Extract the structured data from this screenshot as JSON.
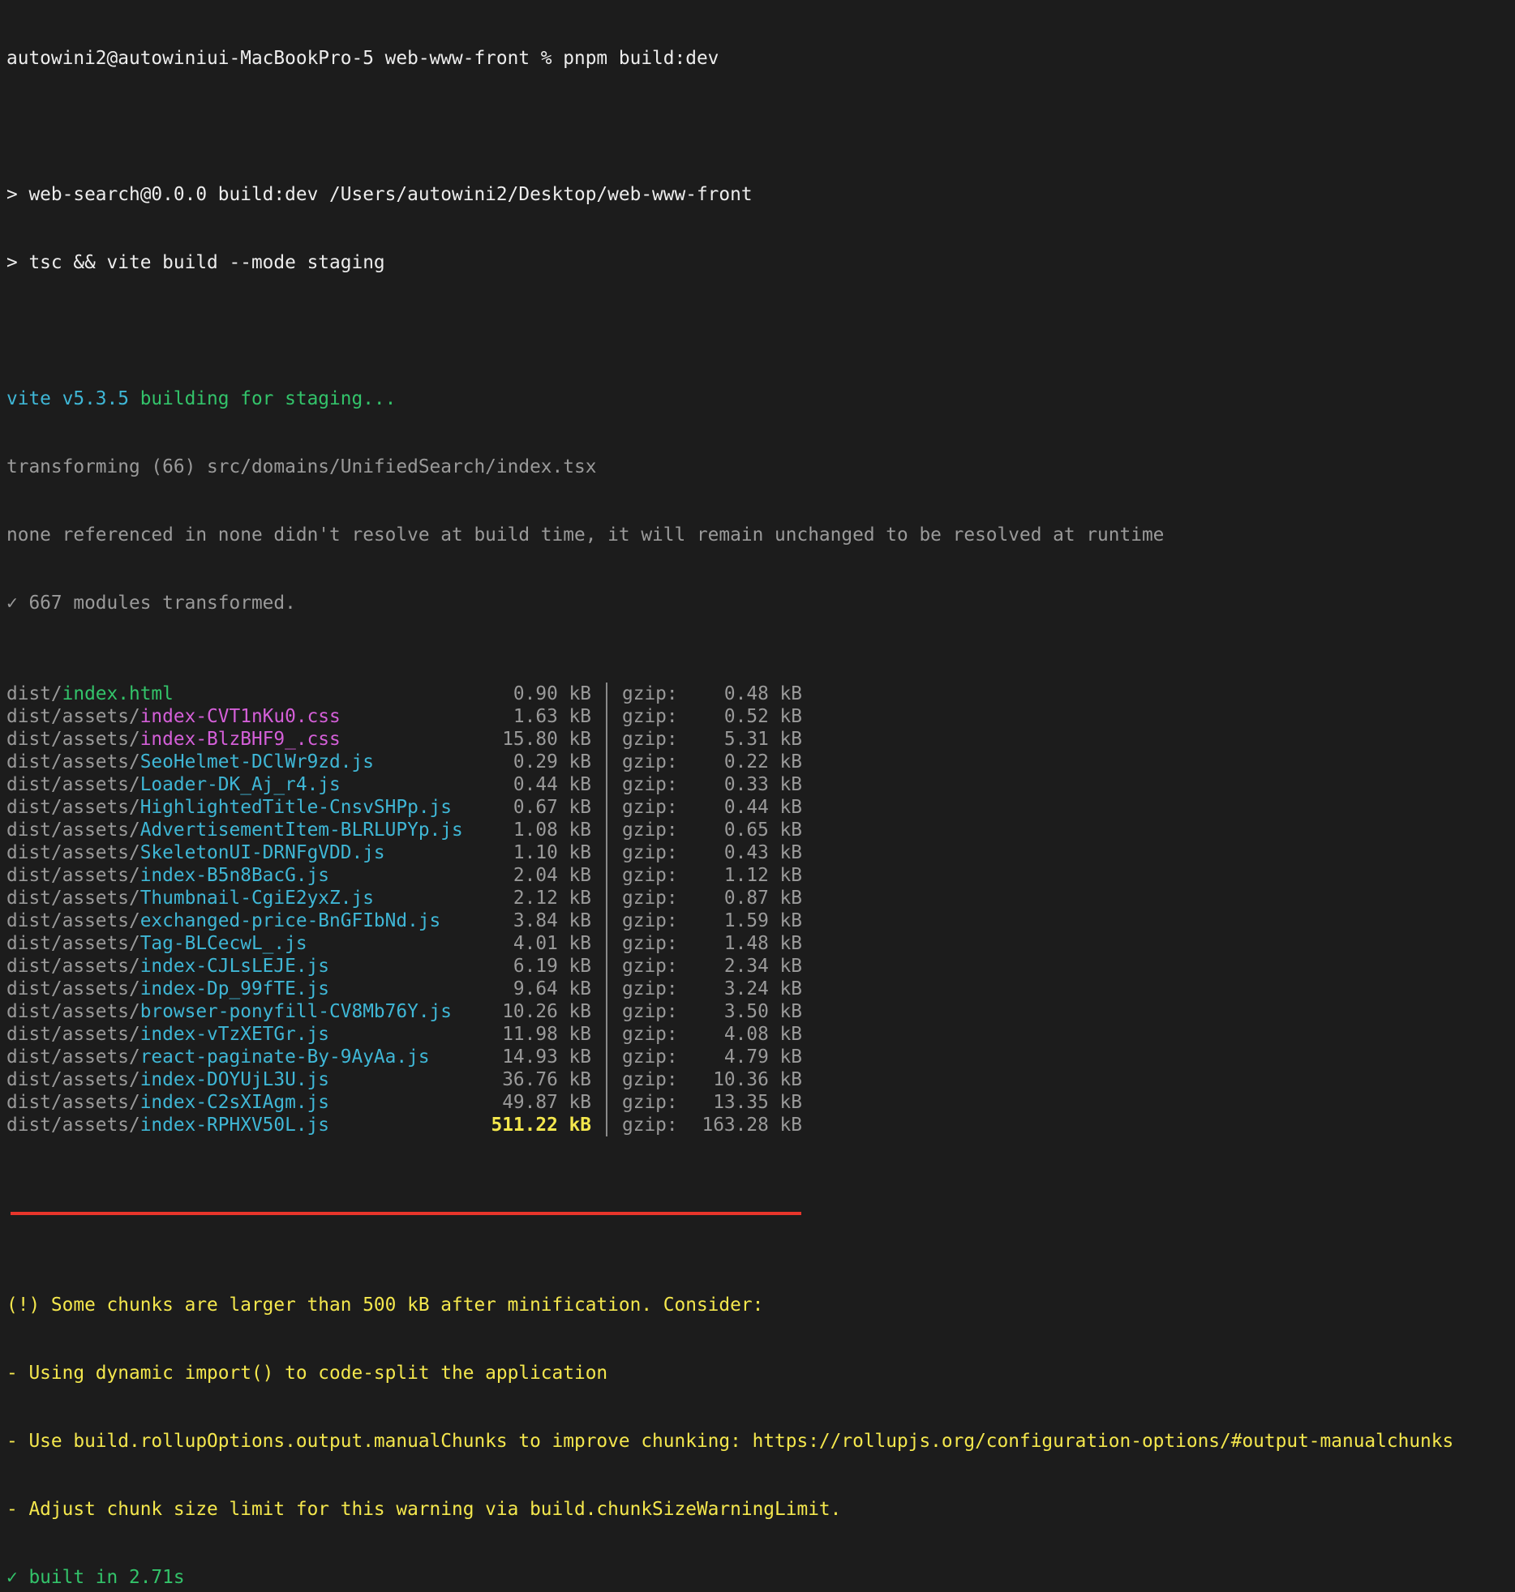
{
  "terminal": {
    "prompt": "autowini2@autowiniui-MacBookPro-5 web-www-front % ",
    "command": "pnpm build:dev",
    "script_line1": "> web-search@0.0.0 build:dev /Users/autowini2/Desktop/web-www-front",
    "script_line2": "> tsc && vite build --mode staging",
    "vite_version": "vite v5.3.5",
    "building": " building for staging...",
    "transforming": "transforming (66) src/domains/UnifiedSearch/index.tsx",
    "warning_resolve": "none referenced in none didn't resolve at build time, it will remain unchanged to be resolved at runtime",
    "modules_transformed": "✓ 667 modules transformed.",
    "gzip_label": "gzip:",
    "files": [
      {
        "dir": "dist/",
        "file": "index.html",
        "kind": "html",
        "size": "0.90 kB",
        "gzip": "0.48 kB"
      },
      {
        "dir": "dist/assets/",
        "file": "index-CVT1nKu0.css",
        "kind": "css",
        "size": "1.63 kB",
        "gzip": "0.52 kB"
      },
      {
        "dir": "dist/assets/",
        "file": "index-BlzBHF9_.css",
        "kind": "css",
        "size": "15.80 kB",
        "gzip": "5.31 kB"
      },
      {
        "dir": "dist/assets/",
        "file": "SeoHelmet-DClWr9zd.js",
        "kind": "js",
        "size": "0.29 kB",
        "gzip": "0.22 kB"
      },
      {
        "dir": "dist/assets/",
        "file": "Loader-DK_Aj_r4.js",
        "kind": "js",
        "size": "0.44 kB",
        "gzip": "0.33 kB"
      },
      {
        "dir": "dist/assets/",
        "file": "HighlightedTitle-CnsvSHPp.js",
        "kind": "js",
        "size": "0.67 kB",
        "gzip": "0.44 kB"
      },
      {
        "dir": "dist/assets/",
        "file": "AdvertisementItem-BLRLUPYp.js",
        "kind": "js",
        "size": "1.08 kB",
        "gzip": "0.65 kB"
      },
      {
        "dir": "dist/assets/",
        "file": "SkeletonUI-DRNFgVDD.js",
        "kind": "js",
        "size": "1.10 kB",
        "gzip": "0.43 kB"
      },
      {
        "dir": "dist/assets/",
        "file": "index-B5n8BacG.js",
        "kind": "js",
        "size": "2.04 kB",
        "gzip": "1.12 kB"
      },
      {
        "dir": "dist/assets/",
        "file": "Thumbnail-CgiE2yxZ.js",
        "kind": "js",
        "size": "2.12 kB",
        "gzip": "0.87 kB"
      },
      {
        "dir": "dist/assets/",
        "file": "exchanged-price-BnGFIbNd.js",
        "kind": "js",
        "size": "3.84 kB",
        "gzip": "1.59 kB"
      },
      {
        "dir": "dist/assets/",
        "file": "Tag-BLCecwL_.js",
        "kind": "js",
        "size": "4.01 kB",
        "gzip": "1.48 kB"
      },
      {
        "dir": "dist/assets/",
        "file": "index-CJLsLEJE.js",
        "kind": "js",
        "size": "6.19 kB",
        "gzip": "2.34 kB"
      },
      {
        "dir": "dist/assets/",
        "file": "index-Dp_99fTE.js",
        "kind": "js",
        "size": "9.64 kB",
        "gzip": "3.24 kB"
      },
      {
        "dir": "dist/assets/",
        "file": "browser-ponyfill-CV8Mb76Y.js",
        "kind": "js",
        "size": "10.26 kB",
        "gzip": "3.50 kB"
      },
      {
        "dir": "dist/assets/",
        "file": "index-vTzXETGr.js",
        "kind": "js",
        "size": "11.98 kB",
        "gzip": "4.08 kB"
      },
      {
        "dir": "dist/assets/",
        "file": "react-paginate-By-9AyAa.js",
        "kind": "js",
        "size": "14.93 kB",
        "gzip": "4.79 kB"
      },
      {
        "dir": "dist/assets/",
        "file": "index-DOYUjL3U.js",
        "kind": "js",
        "size": "36.76 kB",
        "gzip": "10.36 kB"
      },
      {
        "dir": "dist/assets/",
        "file": "index-C2sXIAgm.js",
        "kind": "js",
        "size": "49.87 kB",
        "gzip": "13.35 kB"
      },
      {
        "dir": "dist/assets/",
        "file": "index-RPHXV50L.js",
        "kind": "js",
        "size": "511.22 kB",
        "gzip": "163.28 kB",
        "big": true
      }
    ],
    "chunk_warning": [
      "(!) Some chunks are larger than 500 kB after minification. Consider:",
      "- Using dynamic import() to code-split the application",
      "- Use build.rollupOptions.output.manualChunks to improve chunking: https://rollupjs.org/configuration-options/#output-manualchunks",
      "- Adjust chunk size limit for this warning via build.chunkSizeWarningLimit."
    ],
    "built": "✓ built in 2.71s"
  },
  "colors": {
    "background": "#1c1c1c",
    "cyan": "#3fb7d6",
    "green": "#33c36a",
    "magenta": "#d45fd8",
    "yellow": "#f4e74d",
    "annotation_red": "#e8352b"
  }
}
